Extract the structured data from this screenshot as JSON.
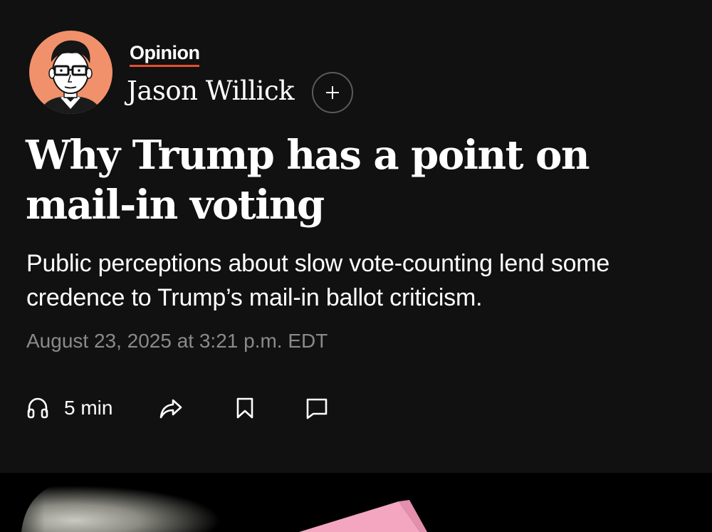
{
  "byline": {
    "section_label": "Opinion",
    "author_name": "Jason Willick",
    "follow_symbol": "+"
  },
  "article": {
    "headline": "Why Trump has a point on mail-in voting",
    "dek": "Public perceptions about slow vote-counting lend some credence to Trump’s mail-in ballot criticism.",
    "timestamp": "August 23, 2025 at 3:21 p.m. EDT"
  },
  "actions": {
    "listen_label": "5 min",
    "icons": [
      "headphones-icon",
      "share-icon",
      "bookmark-icon",
      "comment-icon"
    ]
  },
  "colors": {
    "background": "#111111",
    "accent_underline": "#e34f33",
    "avatar_background": "#f0916b",
    "timestamp": "#8a8a8a",
    "ballot_pink": "#f4a6c1"
  }
}
